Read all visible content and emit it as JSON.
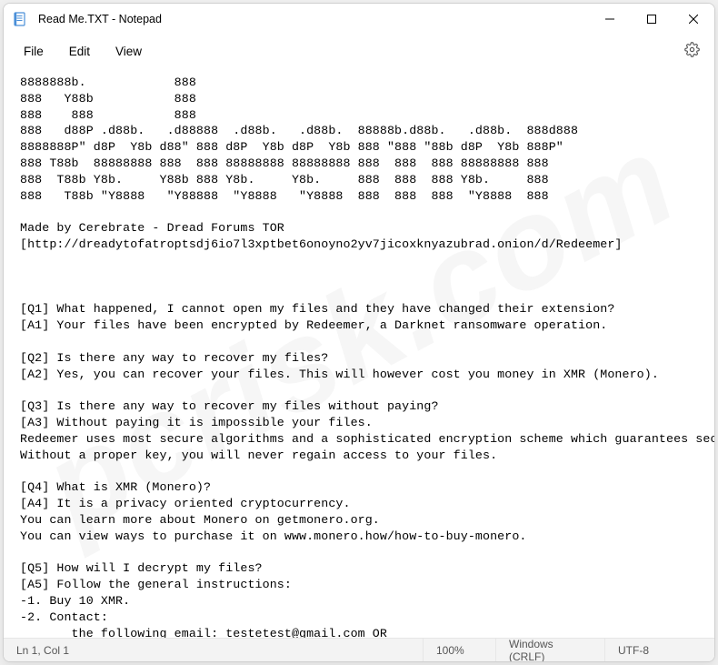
{
  "window": {
    "title": "Read Me.TXT - Notepad"
  },
  "menu": {
    "file": "File",
    "edit": "Edit",
    "view": "View"
  },
  "body": "8888888b.            888\n888   Y88b           888\n888    888           888\n888   d88P .d88b.   .d88888  .d88b.   .d88b.  88888b.d88b.   .d88b.  888d888\n8888888P\" d8P  Y8b d88\" 888 d8P  Y8b d8P  Y8b 888 \"888 \"88b d8P  Y8b 888P\"\n888 T88b  88888888 888  888 88888888 88888888 888  888  888 88888888 888\n888  T88b Y8b.     Y88b 888 Y8b.     Y8b.     888  888  888 Y8b.     888\n888   T88b \"Y8888   \"Y88888  \"Y8888   \"Y8888  888  888  888  \"Y8888  888\n\nMade by Cerebrate - Dread Forums TOR\n[http://dreadytofatroptsdj6io7l3xptbet6onoyno2yv7jicoxknyazubrad.onion/d/Redeemer]\n\n\n\n[Q1] What happened, I cannot open my files and they have changed their extension?\n[A1] Your files have been encrypted by Redeemer, a Darknet ransomware operation.\n\n[Q2] Is there any way to recover my files?\n[A2] Yes, you can recover your files. This will however cost you money in XMR (Monero).\n\n[Q3] Is there any way to recover my files without paying?\n[A3] Without paying it is impossible your files.\nRedeemer uses most secure algorithms and a sophisticated encryption scheme which guarantees security.\nWithout a proper key, you will never regain access to your files.\n\n[Q4] What is XMR (Monero)?\n[A4] It is a privacy oriented cryptocurrency.\nYou can learn more about Monero on getmonero.org.\nYou can view ways to purchase it on www.monero.how/how-to-buy-monero.\n\n[Q5] How will I decrypt my files?\n[A5] Follow the general instructions:\n-1. Buy 10 XMR.\n-2. Contact:\n       the following email: testetest@gmail.com OR\n       the following email: testestes@gmail.com\n\nAfter you established contact send the following key:",
  "status": {
    "cursor": "Ln 1, Col 1",
    "zoom": "100%",
    "line_ending": "Windows (CRLF)",
    "encoding": "UTF-8"
  },
  "watermark": "pcrisk.com"
}
